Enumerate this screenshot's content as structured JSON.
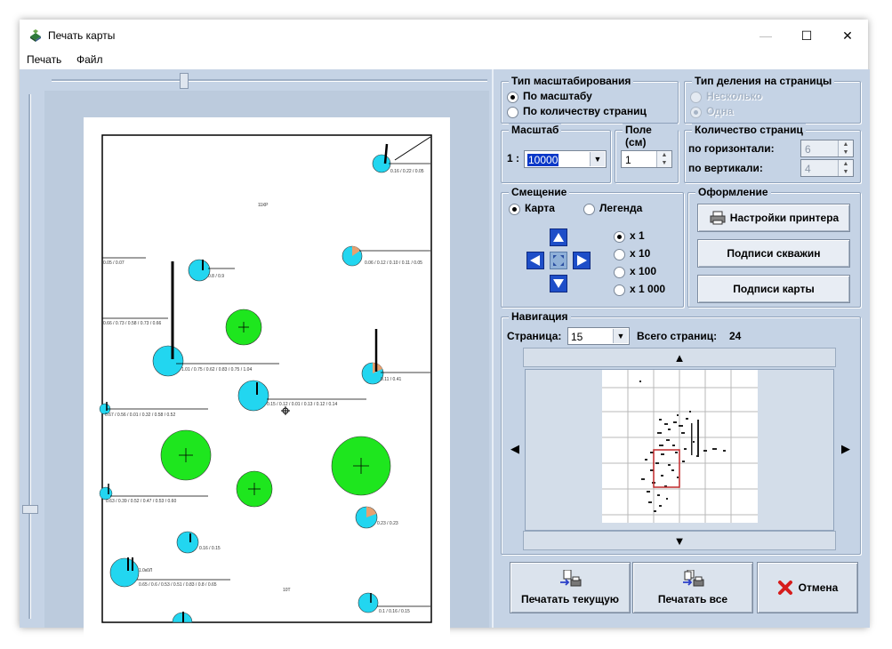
{
  "window": {
    "title": "Печать карты",
    "minimize": "—",
    "maximize": "☐",
    "close": "✕"
  },
  "menu": {
    "print": "Печать",
    "file": "Файл"
  },
  "scale_type": {
    "title": "Тип масштабирования",
    "by_scale": "По масштабу",
    "by_pages": "По количеству страниц",
    "selected": "by_scale"
  },
  "division_type": {
    "title": "Тип деления на страницы",
    "several": "Несколько",
    "one": "Одна",
    "selected": "one",
    "enabled": false
  },
  "scale": {
    "title": "Масштаб",
    "prefix": "1 :",
    "value": "10000"
  },
  "margin": {
    "title": "Поле (см)",
    "value": "1"
  },
  "page_count": {
    "title": "Количество страниц",
    "horizontal_label": "по горизонтали:",
    "horizontal_value": "6",
    "vertical_label": "по вертикали:",
    "vertical_value": "4"
  },
  "offset": {
    "title": "Смещение",
    "map": "Карта",
    "legend": "Легенда",
    "selected": "map",
    "steps": [
      "x 1",
      "x 10",
      "x 100",
      "x 1 000"
    ],
    "selected_step": "x 1"
  },
  "design": {
    "title": "Оформление",
    "printer_settings": "Настройки принтера",
    "well_labels": "Подписи скважин",
    "map_labels": "Подписи карты"
  },
  "navigation": {
    "title": "Навигация",
    "page_label": "Страница:",
    "page_value": "15",
    "total_label": "Всего страниц:",
    "total_value": "24",
    "grid_cols": 6,
    "grid_rows": 6,
    "current_cell": [
      2,
      3
    ]
  },
  "actions": {
    "print_current": "Печатать текущую",
    "print_all": "Печатать все",
    "cancel": "Отмена"
  },
  "colors": {
    "background": "#c5d3e5",
    "well_cyan": "#22d6f0",
    "well_green": "#1ee61e",
    "cancel_red": "#d61c1c",
    "arrow_blue": "#1e4ec8"
  },
  "map_labels": {
    "top_a": "0.16 / 0.22 / 0.05",
    "top_b": "11КР",
    "mid_a": "0.06 / 0.12 / 0.10 / 0.11 / 0.05",
    "mid_b": "0.05 / 0.07",
    "mid_c": "0.8 / 0.9",
    "left_a": "0.66 / 0.73 / 0.58 / 0.73 / 0.66",
    "left_b": "1.01 / 0.75 / 0.62 / 0.83 / 0.75 / 1.04",
    "left_c": "0.11 / 0.41",
    "center_a": "0.15 / 0.12 / 0.01 / 0.13 / 0.12 / 0.14",
    "center_b": "0.67 / 0.56 / 0.01 / 0.32 / 0.58 / 0.52",
    "low_a": "0.63 / 0.39 / 0.52 / 0.47 / 0.53 / 0.60",
    "low_b": "0.23 / 0.23",
    "low_c": "0.16 / 0.15",
    "bot_a": "1.0к0Л",
    "bot_b": "0.65 / 0.6 / 0.53 / 0.51 / 0.83 / 0.8 / 0.65",
    "bot_c": "0.1 / 0.16 / 0.15",
    "bot_d": "10Т"
  }
}
